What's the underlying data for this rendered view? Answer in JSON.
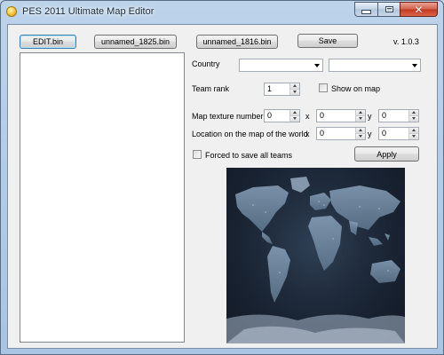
{
  "window": {
    "title": "PES 2011 Ultimate Map Editor",
    "close_symbol": "✕"
  },
  "toolbar": {
    "edit_bin": "EDIT.bin",
    "unnamed_1825": "unnamed_1825.bin",
    "unnamed_1816": "unnamed_1816.bin",
    "save": "Save",
    "version": "v. 1.0.3"
  },
  "form": {
    "country_label": "Country",
    "country_value": "",
    "country_second_value": "",
    "team_rank_label": "Team rank",
    "team_rank_value": "1",
    "show_on_map_label": "Show on map",
    "show_on_map_checked": false,
    "map_texture_label": "Map texture number",
    "map_texture_value": "0",
    "map_texture_x": "0",
    "map_texture_y": "0",
    "location_label": "Location on the map of the world",
    "location_x": "0",
    "location_y": "0",
    "x_label": "x",
    "y_label": "y",
    "forced_save_label": "Forced to save all teams",
    "forced_save_checked": false,
    "apply": "Apply"
  },
  "colors": {
    "accent": "#3c7fb1",
    "map_ocean": "#1a2434",
    "map_land": "#7a93ad",
    "close_button": "#c2381f"
  },
  "icons": {
    "app": "app-icon",
    "minimize": "minimize-icon",
    "maximize": "maximize-icon",
    "close": "close-icon"
  }
}
